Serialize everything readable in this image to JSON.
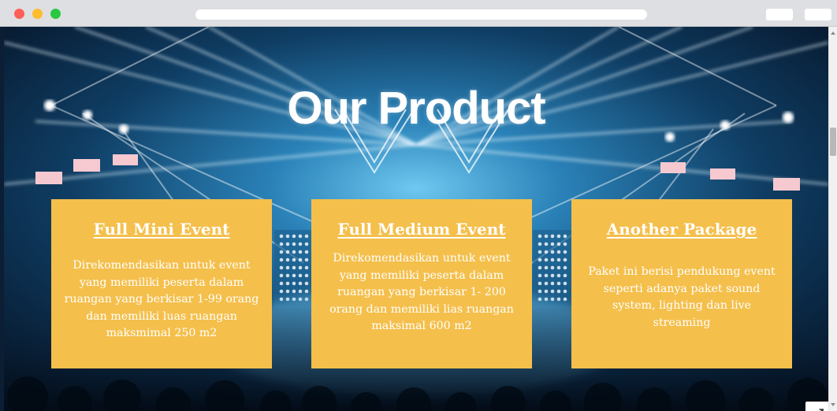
{
  "colors": {
    "card_background": "#f4bf4b",
    "card_text": "#ffffff",
    "window_close": "#fe5f57",
    "window_minimize": "#febc2e",
    "window_maximize": "#28c840",
    "background_stage": "#0b2a47"
  },
  "browser": {
    "url_text": "",
    "traffic_lights": [
      "close-icon",
      "minimize-icon",
      "maximize-icon"
    ]
  },
  "hero": {
    "title": "Our Product"
  },
  "products": [
    {
      "title": "Full Mini Event",
      "description": "Direkomendasikan untuk event yang memiliki peserta dalam ruangan yang berkisar 1-99 orang dan memiliki luas ruangan maksmimal 250 m2"
    },
    {
      "title": "Full Medium Event",
      "description": "Direkomendasikan untuk event yang memiliki peserta dalam ruangan yang berkisar 1- 200 orang dan memiliki lias ruangan maksimal 600 m2"
    },
    {
      "title": "Another Package",
      "description": "Paket ini berisi pendukung event seperti adanya paket sound system, lighting dan live streaming"
    }
  ],
  "controls": {
    "fullscreen_icon": "expand-icon"
  }
}
